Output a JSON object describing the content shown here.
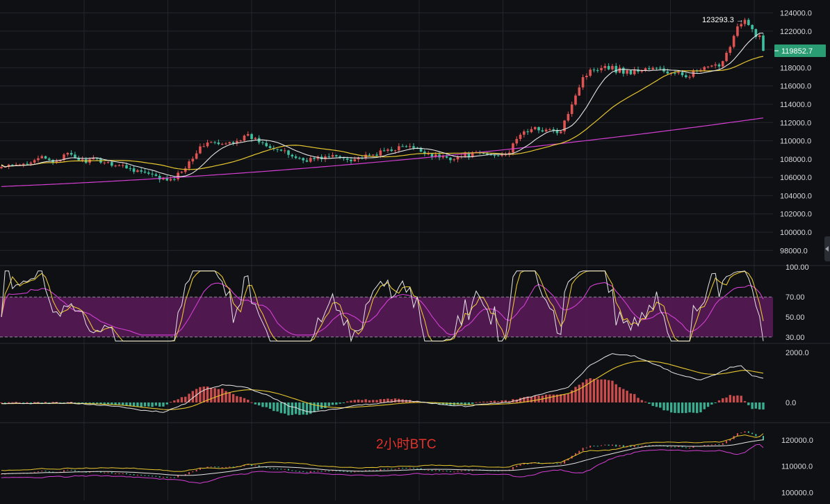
{
  "chart_data": [
    {
      "type": "candlestick",
      "panel": "main",
      "title": "",
      "y_ticks": [
        "124000.0",
        "122000.0",
        "120000.0",
        "118000.0",
        "116000.0",
        "114000.0",
        "112000.0",
        "110000.0",
        "108000.0",
        "106000.0",
        "104000.0",
        "102000.0",
        "100000.0",
        "98000.0"
      ],
      "ylim": [
        96500,
        124800
      ],
      "last_price_label": "119852.7",
      "last_price": 119852.7,
      "high_marker_label": "123293.3",
      "high_marker_value": 123293.3,
      "moving_averages": [
        "white",
        "yellow",
        "magenta"
      ],
      "anchors": [
        [
          0,
          107100
        ],
        [
          5,
          107300
        ],
        [
          10,
          108200
        ],
        [
          14,
          107700
        ],
        [
          18,
          108500
        ],
        [
          22,
          107800
        ],
        [
          26,
          107900
        ],
        [
          30,
          107500
        ],
        [
          34,
          107100
        ],
        [
          38,
          106600
        ],
        [
          42,
          106000
        ],
        [
          46,
          105600
        ],
        [
          49,
          106700
        ],
        [
          53,
          108800
        ],
        [
          56,
          109900
        ],
        [
          60,
          109500
        ],
        [
          64,
          110100
        ],
        [
          67,
          110500
        ],
        [
          71,
          109800
        ],
        [
          75,
          109100
        ],
        [
          78,
          108500
        ],
        [
          82,
          107900
        ],
        [
          86,
          108100
        ],
        [
          90,
          108300
        ],
        [
          95,
          108000
        ],
        [
          100,
          108300
        ],
        [
          105,
          109000
        ],
        [
          110,
          109400
        ],
        [
          114,
          108900
        ],
        [
          118,
          108300
        ],
        [
          122,
          108100
        ],
        [
          126,
          108400
        ],
        [
          130,
          108600
        ],
        [
          134,
          108400
        ],
        [
          138,
          108800
        ],
        [
          141,
          110800
        ],
        [
          145,
          111300
        ],
        [
          148,
          111200
        ],
        [
          152,
          110900
        ],
        [
          155,
          114200
        ],
        [
          158,
          117000
        ],
        [
          161,
          117900
        ],
        [
          164,
          118300
        ],
        [
          167,
          117800
        ],
        [
          171,
          117500
        ],
        [
          175,
          117900
        ],
        [
          179,
          117800
        ],
        [
          183,
          117200
        ],
        [
          187,
          117300
        ],
        [
          190,
          117700
        ],
        [
          194,
          118100
        ],
        [
          196,
          118800
        ],
        [
          198,
          120600
        ],
        [
          200,
          122400
        ],
        [
          202,
          123000
        ],
        [
          204,
          122100
        ],
        [
          206,
          121300
        ],
        [
          207,
          119850
        ]
      ],
      "ma_white_start": 107300,
      "ma_yellow_start": 107400,
      "ma_magenta_start": 105000,
      "ma_magenta_end": 112500,
      "yellow_end": 118800
    },
    {
      "type": "line",
      "panel": "rsi",
      "y_ticks": [
        "100.00",
        "70.00",
        "50.00",
        "30.00"
      ],
      "ylim": [
        25,
        100
      ],
      "band": [
        30,
        70
      ],
      "band_color": "#5a1a5a",
      "series": [
        {
          "color": "#e6e6e6"
        },
        {
          "color": "#e6c630"
        },
        {
          "color": "#d43fd4"
        }
      ]
    },
    {
      "type": "macd",
      "panel": "macd",
      "y_ticks": [
        "2000.0",
        "0.0"
      ],
      "ylim": [
        -750,
        2300
      ],
      "line_colors": [
        "#e6e6e6",
        "#e6c630"
      ],
      "anchors": [
        [
          0,
          -40
        ],
        [
          20,
          -30
        ],
        [
          30,
          -130
        ],
        [
          38,
          -310
        ],
        [
          44,
          -380
        ],
        [
          50,
          -50
        ],
        [
          55,
          500
        ],
        [
          60,
          700
        ],
        [
          66,
          620
        ],
        [
          72,
          300
        ],
        [
          78,
          -130
        ],
        [
          84,
          -390
        ],
        [
          90,
          -280
        ],
        [
          96,
          -120
        ],
        [
          102,
          -40
        ],
        [
          108,
          80
        ],
        [
          114,
          20
        ],
        [
          120,
          -80
        ],
        [
          126,
          -150
        ],
        [
          132,
          -60
        ],
        [
          138,
          10
        ],
        [
          146,
          300
        ],
        [
          154,
          600
        ],
        [
          160,
          1500
        ],
        [
          166,
          1950
        ],
        [
          172,
          1850
        ],
        [
          178,
          1500
        ],
        [
          184,
          1100
        ],
        [
          190,
          900
        ],
        [
          194,
          1100
        ],
        [
          198,
          1400
        ],
        [
          201,
          1450
        ],
        [
          204,
          1080
        ],
        [
          207,
          950
        ]
      ]
    },
    {
      "type": "line",
      "panel": "overview",
      "y_ticks": [
        "120000.0",
        "110000.0",
        "100000.0"
      ],
      "ylim": [
        97000,
        126000
      ],
      "series_colors": [
        "#e6e6e6",
        "#e6c630",
        "#d43fd4"
      ],
      "label": "2小时BTC"
    }
  ],
  "theme": {
    "background": "#0f1013",
    "grid": "#22252b",
    "up": "#e05353",
    "down": "#3fbf9f",
    "axis_text": "#d7d9dd",
    "price_tag_bg": "#2a9d75"
  }
}
